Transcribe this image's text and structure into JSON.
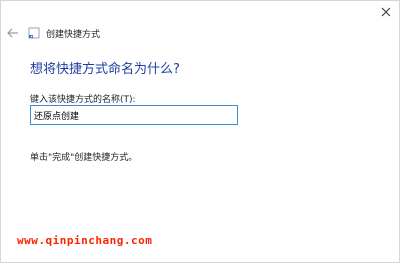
{
  "window": {
    "close_glyph": "✕"
  },
  "nav": {
    "back_glyph": "←",
    "wizard_title": "创建快捷方式",
    "icon": "shortcut-wizard-icon"
  },
  "main": {
    "heading": "想将快捷方式命名为什么?",
    "field_label": "键入该快捷方式的名称(T):",
    "name_value": "还原点创建",
    "hint": "单击\"完成\"创建快捷方式。"
  },
  "watermark": {
    "text": "www.qinpinchang.com"
  },
  "colors": {
    "heading": "#1f3fa0",
    "input_border": "#3b8fd6",
    "watermark": "#ff2200"
  }
}
